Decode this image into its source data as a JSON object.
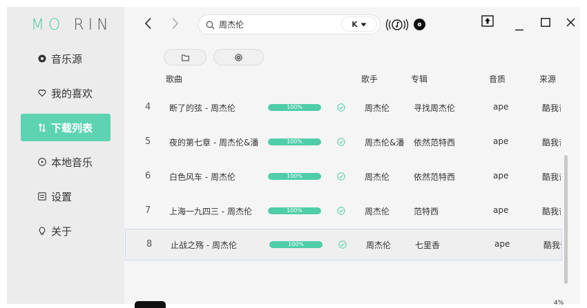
{
  "app": {
    "logo_accent": "MO",
    "logo_rest": "RIN",
    "accent_color": "#4fcda8",
    "window_controls": [
      "minimize-icon",
      "maximize-icon",
      "close-icon"
    ]
  },
  "sidebar": {
    "items": [
      {
        "label": "音乐源",
        "icon": "record-icon",
        "active": false
      },
      {
        "label": "我的喜欢",
        "icon": "heart-icon",
        "active": false
      },
      {
        "label": "下载列表",
        "icon": "sort-arrows-icon",
        "active": true
      },
      {
        "label": "本地音乐",
        "icon": "play-circle-icon",
        "active": false
      },
      {
        "label": "设置",
        "icon": "settings-icon",
        "active": false
      },
      {
        "label": "关于",
        "icon": "bulb-icon",
        "active": false
      }
    ]
  },
  "toolbar": {
    "search_value": "周杰伦",
    "source_badge": "K",
    "toolbar_icons": [
      "back-icon",
      "forward-icon",
      "search-icon",
      "chevron-down-icon",
      "listening-icon",
      "vinyl-icon",
      "upload-icon"
    ]
  },
  "actions": {
    "icons": [
      "folder-icon",
      "clear-icon"
    ]
  },
  "table": {
    "headers": {
      "song": "歌曲",
      "singer": "歌手",
      "album": "专辑",
      "quality": "音质",
      "source": "来源"
    },
    "rows": [
      {
        "num": "4",
        "song": "断了的弦 - 周杰伦",
        "progress": "100%",
        "singer": "周杰伦",
        "album": "寻找周杰伦",
        "quality": "ape",
        "source": "酷我音乐"
      },
      {
        "num": "5",
        "song": "夜的第七章 - 周杰伦&潘",
        "progress": "100%",
        "singer": "周杰伦&潘",
        "album": "依然范特西",
        "quality": "ape",
        "source": "酷我音乐"
      },
      {
        "num": "6",
        "song": "白色风车 - 周杰伦",
        "progress": "100%",
        "singer": "周杰伦",
        "album": "依然范特西",
        "quality": "ape",
        "source": "酷我音乐"
      },
      {
        "num": "7",
        "song": "上海一九四三 - 周杰伦",
        "progress": "100%",
        "singer": "周杰伦",
        "album": "范特西",
        "quality": "ape",
        "source": "酷我音乐"
      },
      {
        "num": "8",
        "song": "止战之殇 - 周杰伦",
        "progress": "100%",
        "singer": "周杰伦",
        "album": "七里香",
        "quality": "ape",
        "source": "酷我音乐",
        "selected": true
      }
    ]
  },
  "player": {
    "volume_label": "4%"
  }
}
